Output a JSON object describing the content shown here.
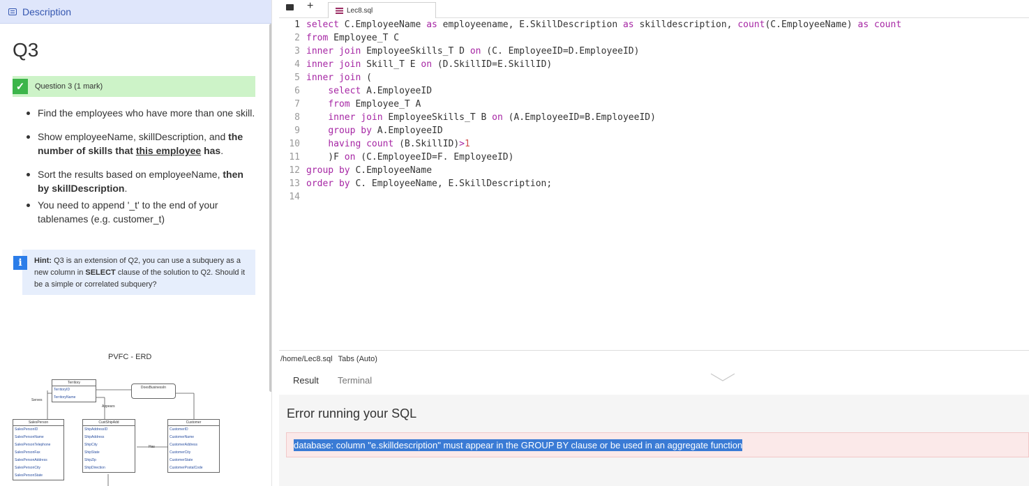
{
  "left_panel": {
    "header_label": "Description",
    "question_title": "Q3",
    "question_banner": "Question 3 (1 mark)",
    "bullets": [
      {
        "parts": [
          {
            "t": "Find the employees who have more than one skill.",
            "s": ""
          }
        ]
      },
      {
        "parts": [
          {
            "t": "Show employeeName, skillDescription, and ",
            "s": ""
          },
          {
            "t": "the number of skills that ",
            "s": "b"
          },
          {
            "t": "this employee",
            "s": "u"
          },
          {
            "t": " has",
            "s": "b"
          },
          {
            "t": ".",
            "s": ""
          }
        ]
      },
      {
        "parts": [
          {
            "t": "Sort the results based on employeeName, ",
            "s": ""
          },
          {
            "t": "then by skillDescription",
            "s": "b"
          },
          {
            "t": ".",
            "s": ""
          }
        ]
      },
      {
        "parts": [
          {
            "t": "You need to append '_t' to the end of your tablenames (e.g. customer_t)",
            "s": ""
          }
        ]
      }
    ],
    "hint": {
      "prefix": "Hint:",
      "text_a": " Q3 is an extension of Q2, you can use a subquery as a new column in ",
      "bold": "SELECT",
      "text_b": " clause of the solution to Q2. Should it be a simple or correlated subquery?"
    },
    "erd": {
      "title": "PVFC - ERD",
      "territory": {
        "name": "Territory",
        "fields": [
          "TerritoryID",
          "TerritoryName"
        ]
      },
      "does_business": {
        "name": "DoesBusinessIn"
      },
      "salesperson": {
        "name": "SalesPerson",
        "fields": [
          "SalesPersonID",
          "SalesPersonName",
          "SalesPersonTelephone",
          "SalesPersonFax",
          "SalesPersonAddress",
          "SalesPersonCity",
          "SalesPersonState"
        ]
      },
      "custshipadd": {
        "name": "CustShipAdd",
        "fields": [
          "ShipAddressID",
          "ShipAddress",
          "ShipCity",
          "ShipState",
          "ShipZip",
          "ShipDirection"
        ]
      },
      "customer": {
        "name": "Customer",
        "fields": [
          "CustomerID",
          "CustomerName",
          "CustomerAddress",
          "CustomerCity",
          "CustomerState",
          "CustomerPostalCode"
        ]
      },
      "labels": {
        "serves": "Serves",
        "appears": "Appears",
        "has": "Has"
      }
    }
  },
  "editor": {
    "tab_label": "Lec8.sql",
    "lines": [
      [
        [
          "kw",
          "select"
        ],
        [
          "c",
          " C.EmployeeName "
        ],
        [
          "kw",
          "as"
        ],
        [
          "c",
          " employeename, E.SkillDescription "
        ],
        [
          "kw",
          "as"
        ],
        [
          "c",
          " skilldescription, "
        ],
        [
          "kw",
          "count"
        ],
        [
          "c",
          "(C.EmployeeName) "
        ],
        [
          "kw",
          "as"
        ],
        [
          "c",
          " "
        ],
        [
          "kw",
          "count"
        ]
      ],
      [
        [
          "kw",
          "from"
        ],
        [
          "c",
          " Employee_T C"
        ]
      ],
      [
        [
          "kw",
          "inner join"
        ],
        [
          "c",
          " EmployeeSkills_T D "
        ],
        [
          "kw",
          "on"
        ],
        [
          "c",
          " (C. EmployeeID=D.EmployeeID)"
        ]
      ],
      [
        [
          "kw",
          "inner join"
        ],
        [
          "c",
          " Skill_T E "
        ],
        [
          "kw",
          "on"
        ],
        [
          "c",
          " (D.SkillID=E.SkillID)"
        ]
      ],
      [
        [
          "kw",
          "inner join"
        ],
        [
          "c",
          " ("
        ]
      ],
      [
        [
          "c",
          "    "
        ],
        [
          "kw",
          "select"
        ],
        [
          "c",
          " A.EmployeeID"
        ]
      ],
      [
        [
          "c",
          "    "
        ],
        [
          "kw",
          "from"
        ],
        [
          "c",
          " Employee_T A"
        ]
      ],
      [
        [
          "c",
          "    "
        ],
        [
          "kw",
          "inner join"
        ],
        [
          "c",
          " EmployeeSkills_T B "
        ],
        [
          "kw",
          "on"
        ],
        [
          "c",
          " (A.EmployeeID=B.EmployeeID)"
        ]
      ],
      [
        [
          "c",
          "    "
        ],
        [
          "kw",
          "group by"
        ],
        [
          "c",
          " A.EmployeeID"
        ]
      ],
      [
        [
          "c",
          "    "
        ],
        [
          "kw",
          "having"
        ],
        [
          "c",
          " "
        ],
        [
          "kw",
          "count"
        ],
        [
          "c",
          " (B.SkillID)"
        ],
        [
          "kw",
          ">"
        ],
        [
          "num",
          "1"
        ]
      ],
      [
        [
          "c",
          "    )F "
        ],
        [
          "kw",
          "on"
        ],
        [
          "c",
          " (C.EmployeeID=F. EmployeeID)"
        ]
      ],
      [
        [
          "kw",
          "group by"
        ],
        [
          "c",
          " C.EmployeeName"
        ]
      ],
      [
        [
          "kw",
          "order by"
        ],
        [
          "c",
          " C. EmployeeName, E.SkillDescription;"
        ]
      ],
      []
    ],
    "active_lines": [
      1
    ]
  },
  "status_bar": {
    "path": "/home/Lec8.sql",
    "mode": "Tabs (Auto)"
  },
  "results": {
    "tabs": [
      "Result",
      "Terminal"
    ],
    "error_title": "Error running your SQL",
    "error_message": "database: column \"e.skilldescription\" must appear in the GROUP BY clause or be used in an aggregate function"
  },
  "colors": {
    "keyword": "#a626a4",
    "error_bg": "#fbe9e9",
    "header_bg": "#dfe6fb",
    "accent": "#3557b0"
  }
}
